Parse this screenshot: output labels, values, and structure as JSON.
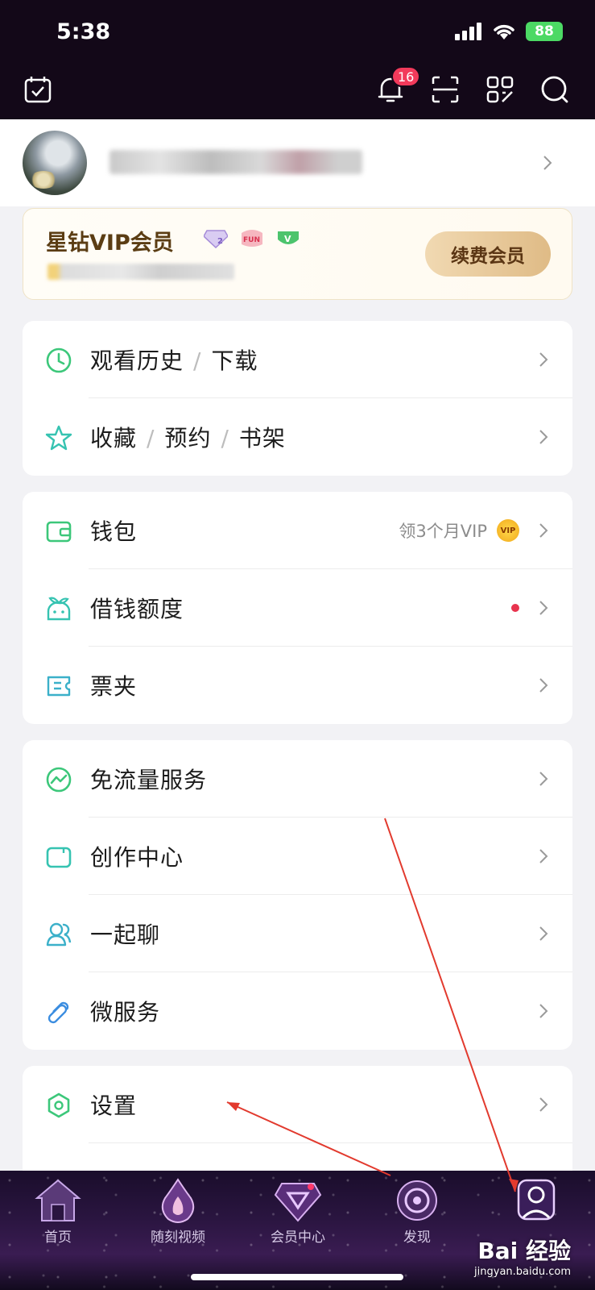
{
  "status_bar": {
    "time": "5:38",
    "battery": "88"
  },
  "header": {
    "notification_count": "16"
  },
  "vip": {
    "title": "星钻VIP会员",
    "renew_label": "续费会员",
    "fun_badge": "FUN",
    "v_badge": "V"
  },
  "menu_group_1": [
    {
      "parts": [
        "观看历史",
        "下载"
      ],
      "icon": "clock-icon"
    },
    {
      "parts": [
        "收藏",
        "预约",
        "书架"
      ],
      "icon": "star-icon"
    }
  ],
  "menu_group_2": [
    {
      "label": "钱包",
      "icon": "wallet-icon",
      "extra": "领3个月VIP",
      "coin": "VIP"
    },
    {
      "label": "借钱额度",
      "icon": "loan-icon"
    },
    {
      "label": "票夹",
      "icon": "ticket-icon"
    }
  ],
  "menu_group_3": [
    {
      "label": "免流量服务",
      "icon": "traffic-icon"
    },
    {
      "label": "创作中心",
      "icon": "camera-icon"
    },
    {
      "label": "一起聊",
      "icon": "chat-icon"
    },
    {
      "label": "微服务",
      "icon": "link-icon"
    }
  ],
  "menu_group_4": [
    {
      "label": "设置",
      "icon": "settings-icon"
    }
  ],
  "tabbar": [
    {
      "label": "首页",
      "icon": "home-icon"
    },
    {
      "label": "随刻视频",
      "icon": "flame-icon"
    },
    {
      "label": "会员中心",
      "icon": "diamond-icon"
    },
    {
      "label": "发现",
      "icon": "discover-icon"
    },
    {
      "label": "",
      "icon": "profile-icon"
    }
  ],
  "watermark": {
    "brand": "Bai 经验",
    "url": "jingyan.baidu.com"
  },
  "colors": {
    "header_bg": "#130818",
    "accent_green": "#3cc77a",
    "badge_red": "#f23a5b",
    "vip_gold": "#dfbb86"
  }
}
